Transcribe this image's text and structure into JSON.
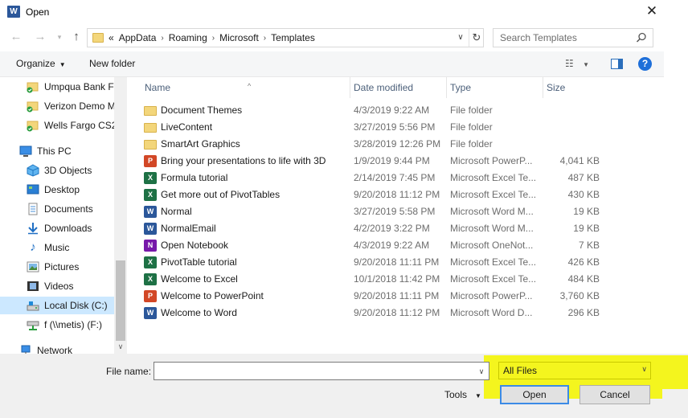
{
  "window": {
    "title": "Open",
    "app_icon_letter": "W"
  },
  "address": {
    "prefix": "«",
    "crumbs": [
      "AppData",
      "Roaming",
      "Microsoft",
      "Templates"
    ],
    "search_placeholder": "Search Templates"
  },
  "toolbar": {
    "organize": "Organize",
    "new_folder": "New folder"
  },
  "nav": {
    "items": [
      {
        "label": "Umpqua Bank Fi",
        "icon": "shared-folder-icon"
      },
      {
        "label": "Verizon Demo M",
        "icon": "shared-folder-icon"
      },
      {
        "label": "Wells Fargo CS2",
        "icon": "shared-folder-icon"
      },
      {
        "label": "This PC",
        "icon": "pc-icon"
      },
      {
        "label": "3D Objects",
        "icon": "cube-icon"
      },
      {
        "label": "Desktop",
        "icon": "desktop-icon"
      },
      {
        "label": "Documents",
        "icon": "documents-icon"
      },
      {
        "label": "Downloads",
        "icon": "download-icon"
      },
      {
        "label": "Music",
        "icon": "music-icon"
      },
      {
        "label": "Pictures",
        "icon": "pictures-icon"
      },
      {
        "label": "Videos",
        "icon": "videos-icon"
      },
      {
        "label": "Local Disk (C:)",
        "icon": "drive-icon"
      },
      {
        "label": "f (\\\\metis) (F:)",
        "icon": "network-drive-icon"
      },
      {
        "label": "Network",
        "icon": "network-icon"
      }
    ]
  },
  "columns": {
    "name": "Name",
    "date": "Date modified",
    "type": "Type",
    "size": "Size"
  },
  "files": [
    {
      "name": "Document Themes",
      "date": "4/3/2019 9:22 AM",
      "type": "File folder",
      "size": "",
      "kind": "folder"
    },
    {
      "name": "LiveContent",
      "date": "3/27/2019 5:56 PM",
      "type": "File folder",
      "size": "",
      "kind": "folder"
    },
    {
      "name": "SmartArt Graphics",
      "date": "3/28/2019 12:26 PM",
      "type": "File folder",
      "size": "",
      "kind": "folder"
    },
    {
      "name": "Bring your presentations to life with 3D",
      "date": "1/9/2019 9:44 PM",
      "type": "Microsoft PowerP...",
      "size": "4,041 KB",
      "kind": "ppt"
    },
    {
      "name": "Formula tutorial",
      "date": "2/14/2019 7:45 PM",
      "type": "Microsoft Excel Te...",
      "size": "487 KB",
      "kind": "xls"
    },
    {
      "name": "Get more out of PivotTables",
      "date": "9/20/2018 11:12 PM",
      "type": "Microsoft Excel Te...",
      "size": "430 KB",
      "kind": "xls"
    },
    {
      "name": "Normal",
      "date": "3/27/2019 5:58 PM",
      "type": "Microsoft Word M...",
      "size": "19 KB",
      "kind": "doc"
    },
    {
      "name": "NormalEmail",
      "date": "4/2/2019 3:22 PM",
      "type": "Microsoft Word M...",
      "size": "19 KB",
      "kind": "doc"
    },
    {
      "name": "Open Notebook",
      "date": "4/3/2019 9:22 AM",
      "type": "Microsoft OneNot...",
      "size": "7 KB",
      "kind": "one"
    },
    {
      "name": "PivotTable tutorial",
      "date": "9/20/2018 11:11 PM",
      "type": "Microsoft Excel Te...",
      "size": "426 KB",
      "kind": "xls"
    },
    {
      "name": "Welcome to Excel",
      "date": "10/1/2018 11:42 PM",
      "type": "Microsoft Excel Te...",
      "size": "484 KB",
      "kind": "xls"
    },
    {
      "name": "Welcome to PowerPoint",
      "date": "9/20/2018 11:11 PM",
      "type": "Microsoft PowerP...",
      "size": "3,760 KB",
      "kind": "ppt"
    },
    {
      "name": "Welcome to Word",
      "date": "9/20/2018 11:12 PM",
      "type": "Microsoft Word D...",
      "size": "296 KB",
      "kind": "doc"
    }
  ],
  "footer": {
    "file_name_label": "File name:",
    "file_name_value": "",
    "file_type": "All Files",
    "tools": "Tools",
    "open": "Open",
    "cancel": "Cancel"
  },
  "colors": {
    "highlight": "#f4f51e",
    "accent": "#3c8be6",
    "selected": "#cce8ff"
  }
}
